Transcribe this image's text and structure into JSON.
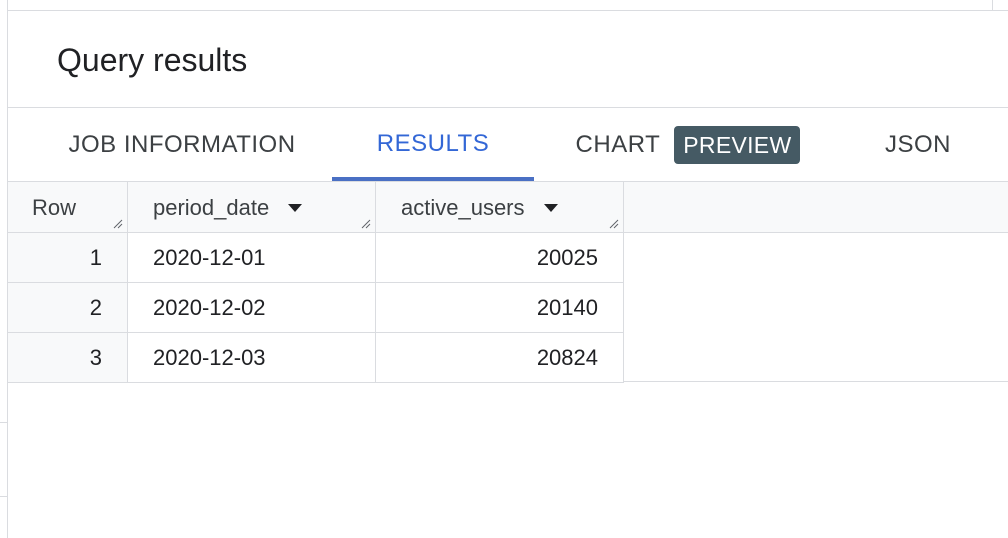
{
  "panel": {
    "title": "Query results"
  },
  "tabs": [
    {
      "label": "JOB INFORMATION",
      "active": false
    },
    {
      "label": "RESULTS",
      "active": true
    },
    {
      "label": "CHART",
      "badge": "PREVIEW",
      "active": false
    },
    {
      "label": "JSON",
      "active": false
    }
  ],
  "table": {
    "columns": [
      "Row",
      "period_date",
      "active_users"
    ],
    "rows": [
      {
        "row": "1",
        "period_date": "2020-12-01",
        "active_users": "20025"
      },
      {
        "row": "2",
        "period_date": "2020-12-02",
        "active_users": "20140"
      },
      {
        "row": "3",
        "period_date": "2020-12-03",
        "active_users": "20824"
      }
    ]
  },
  "icons": {
    "sort": "caret-down-icon",
    "resize": "resize-handle-icon"
  },
  "colors": {
    "active_tab": "#3367d6",
    "badge_bg": "#455a64",
    "border": "#dadce0",
    "header_bg": "#f8f9fa"
  }
}
